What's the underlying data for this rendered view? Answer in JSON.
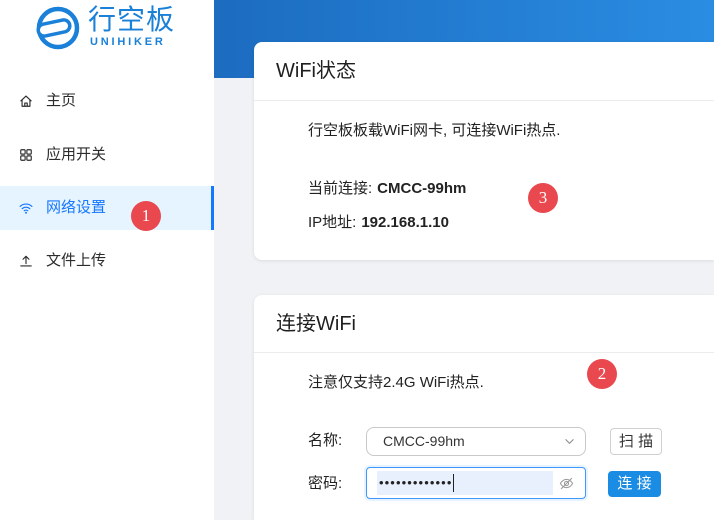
{
  "logo": {
    "name": "行空板",
    "subtitle": "UNIHIKER",
    "icon": "unihiker-logo-icon"
  },
  "sidebar": {
    "items": [
      {
        "label": "主页",
        "icon": "home-icon",
        "active": false
      },
      {
        "label": "应用开关",
        "icon": "appstore-icon",
        "active": false
      },
      {
        "label": "网络设置",
        "icon": "wifi-icon",
        "active": true
      },
      {
        "label": "文件上传",
        "icon": "upload-icon",
        "active": false
      }
    ]
  },
  "annotations": {
    "network_settings": "1",
    "connect_wifi": "2",
    "wifi_status": "3"
  },
  "wifi_status": {
    "title": "WiFi状态",
    "description": "行空板板载WiFi网卡, 可连接WiFi热点.",
    "current_label": "当前连接:",
    "current_value": "CMCC-99hm",
    "ip_label": "IP地址:",
    "ip_value": "192.168.1.10"
  },
  "connect_wifi": {
    "title": "连接WiFi",
    "note": "注意仅支持2.4G WiFi热点.",
    "name_label": "名称:",
    "name_value": "CMCC-99hm",
    "name_dropdown_icon": "chevron-down-icon",
    "scan_button": "扫 描",
    "password_label": "密码:",
    "password_masked": "•••••••••••••",
    "password_toggle_icon": "eye-invisible-icon",
    "connect_button": "连 接"
  },
  "colors": {
    "accent": "#1677ff",
    "header_start": "#1c6cc0",
    "header_end": "#2a8de2",
    "annotation": "#e8484e",
    "active_bg": "#e6f4ff",
    "logo": "#1a80d8",
    "primary_button": "#1a8ce4"
  }
}
